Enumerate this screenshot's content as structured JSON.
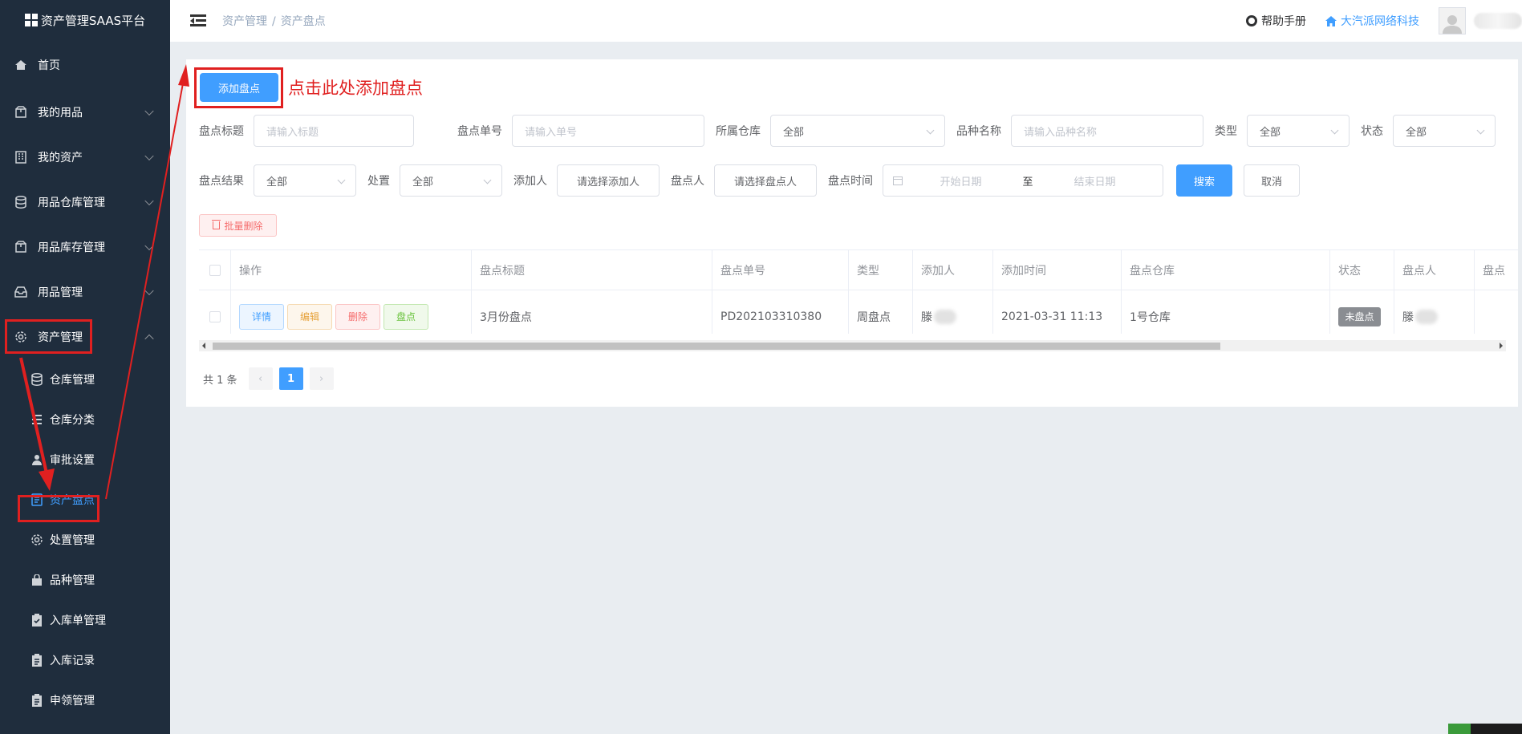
{
  "app": {
    "title": "资产管理SAAS平台"
  },
  "sidebar": {
    "items": [
      {
        "label": "首页",
        "icon": "home-icon",
        "has_arrow": false
      },
      {
        "label": "我的用品",
        "icon": "box-icon",
        "has_arrow": true
      },
      {
        "label": "我的资产",
        "icon": "building-icon",
        "has_arrow": true
      },
      {
        "label": "用品仓库管理",
        "icon": "database-icon",
        "has_arrow": true
      },
      {
        "label": "用品库存管理",
        "icon": "box-icon",
        "has_arrow": true
      },
      {
        "label": "用品管理",
        "icon": "inbox-icon",
        "has_arrow": true
      },
      {
        "label": "资产管理",
        "icon": "gear-icon",
        "has_arrow": true,
        "expanded": true
      }
    ],
    "sub_items": [
      {
        "label": "仓库管理",
        "icon": "database-icon"
      },
      {
        "label": "仓库分类",
        "icon": "list-icon"
      },
      {
        "label": "审批设置",
        "icon": "user-icon"
      },
      {
        "label": "资产盘点",
        "icon": "document-icon",
        "active": true
      },
      {
        "label": "处置管理",
        "icon": "gear-icon"
      },
      {
        "label": "品种管理",
        "icon": "bag-icon"
      },
      {
        "label": "入库单管理",
        "icon": "clipboard-check-icon"
      },
      {
        "label": "入库记录",
        "icon": "clipboard-icon"
      },
      {
        "label": "申领管理",
        "icon": "clipboard-icon"
      }
    ]
  },
  "header": {
    "breadcrumb": [
      "资产管理",
      "资产盘点"
    ],
    "breadcrumb_sep": "/",
    "help": "帮助手册",
    "company": "大汽派网络科技"
  },
  "toolbar": {
    "add_label": "添加盘点",
    "annotation": "点击此处添加盘点"
  },
  "filters": {
    "title_label": "盘点标题",
    "title_placeholder": "请输入标题",
    "no_label": "盘点单号",
    "no_placeholder": "请输入单号",
    "warehouse_label": "所属仓库",
    "warehouse_value": "全部",
    "variety_label": "品种名称",
    "variety_placeholder": "请输入品种名称",
    "type_label": "类型",
    "type_value": "全部",
    "status_label": "状态",
    "status_value": "全部",
    "result_label": "盘点结果",
    "result_value": "全部",
    "dispose_label": "处置",
    "dispose_value": "全部",
    "adder_label": "添加人",
    "adder_button": "请选择添加人",
    "checker_label": "盘点人",
    "checker_button": "请选择盘点人",
    "time_label": "盘点时间",
    "start_placeholder": "开始日期",
    "range_sep": "至",
    "end_placeholder": "结束日期",
    "search_label": "搜索",
    "cancel_label": "取消"
  },
  "batch_delete": "批量删除",
  "table": {
    "columns": [
      "操作",
      "盘点标题",
      "盘点单号",
      "类型",
      "添加人",
      "添加时间",
      "盘点仓库",
      "状态",
      "盘点人",
      "盘点"
    ],
    "actions": [
      "详情",
      "编辑",
      "删除",
      "盘点"
    ],
    "rows": [
      {
        "title": "3月份盘点",
        "no": "PD202103310380",
        "type": "周盘点",
        "adder": "滕",
        "time": "2021-03-31 11:13",
        "warehouse": "1号仓库",
        "status": "未盘点",
        "checker": "滕"
      }
    ]
  },
  "pagination": {
    "total_text": "共 1 条",
    "current": "1",
    "prev": "‹",
    "next": "›"
  },
  "colors": {
    "primary": "#409eff",
    "sidebar_bg": "#1f2d3d",
    "annotation_red": "#e02020"
  }
}
